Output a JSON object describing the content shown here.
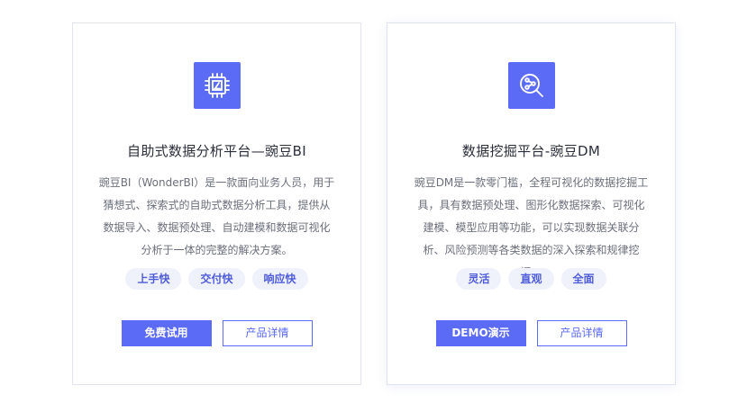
{
  "colors": {
    "accent": "#5b6bf5",
    "tag_bg": "#eff1fb",
    "tag_text": "#4f5cd9",
    "title_text": "#2b2f3a",
    "desc_text": "#6b6f7b"
  },
  "cards": [
    {
      "icon": "chip-icon",
      "title": "自助式数据分析平台—豌豆BI",
      "description": "豌豆BI（WonderBI）是一款面向业务人员，用于猜想式、探索式的自助式数据分析工具，提供从数据导入、数据预处理、自动建模和数据可视化分析于一体的完整的解决方案。",
      "tags": [
        "上手快",
        "交付快",
        "响应快"
      ],
      "primary_button": "免费试用",
      "secondary_button": "产品详情"
    },
    {
      "icon": "data-mining-search-icon",
      "title": "数据挖掘平台-豌豆DM",
      "description": "豌豆DM是一款零门槛，全程可视化的数据挖掘工具，具有数据预处理、图形化数据探索、可视化建模、模型应用等功能，可以实现数据关联分析、风险预测等各类数据的深入探索和规律挖掘。",
      "tags": [
        "灵活",
        "直观",
        "全面"
      ],
      "primary_button": "DEMO演示",
      "secondary_button": "产品详情"
    }
  ]
}
